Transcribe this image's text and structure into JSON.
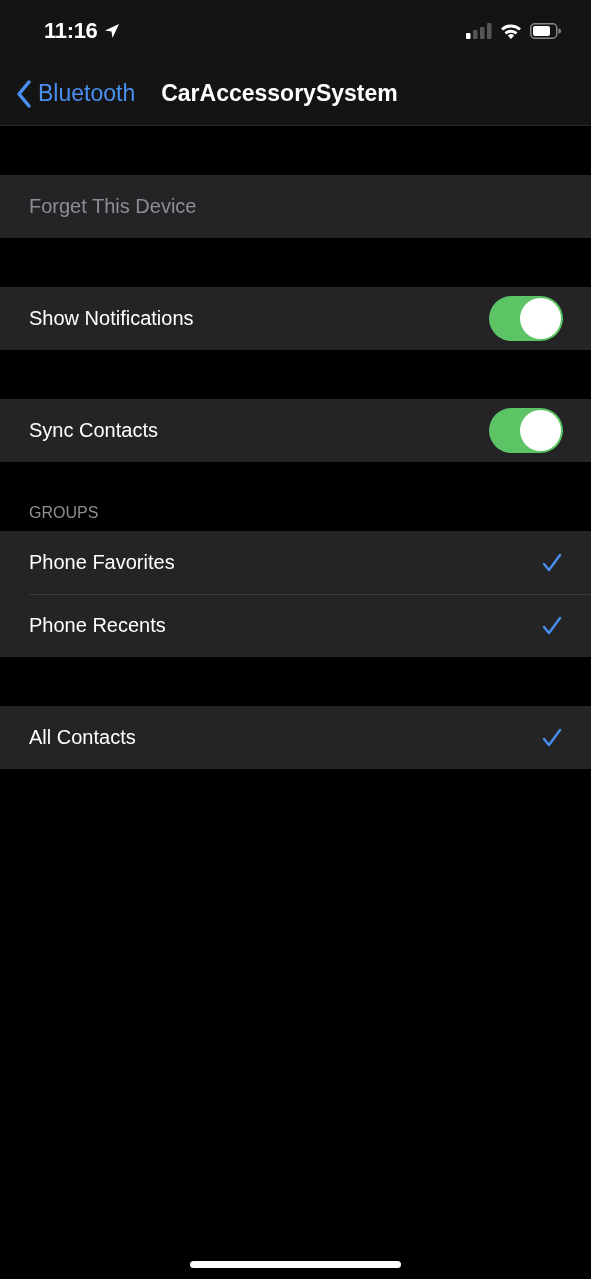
{
  "status_bar": {
    "time": "11:16"
  },
  "nav": {
    "back_label": "Bluetooth",
    "title": "CarAccessorySystem"
  },
  "sections": [
    {
      "rows": [
        {
          "kind": "action",
          "label": "Forget This Device",
          "disabled": true
        }
      ]
    },
    {
      "rows": [
        {
          "kind": "toggle",
          "label": "Show Notifications",
          "on": true
        }
      ]
    },
    {
      "rows": [
        {
          "kind": "toggle",
          "label": "Sync Contacts",
          "on": true
        }
      ]
    },
    {
      "header": "GROUPS",
      "rows": [
        {
          "kind": "check",
          "label": "Phone Favorites",
          "checked": true
        },
        {
          "kind": "check",
          "label": "Phone Recents",
          "checked": true
        }
      ]
    },
    {
      "rows": [
        {
          "kind": "check",
          "label": "All Contacts",
          "checked": true
        }
      ]
    }
  ]
}
